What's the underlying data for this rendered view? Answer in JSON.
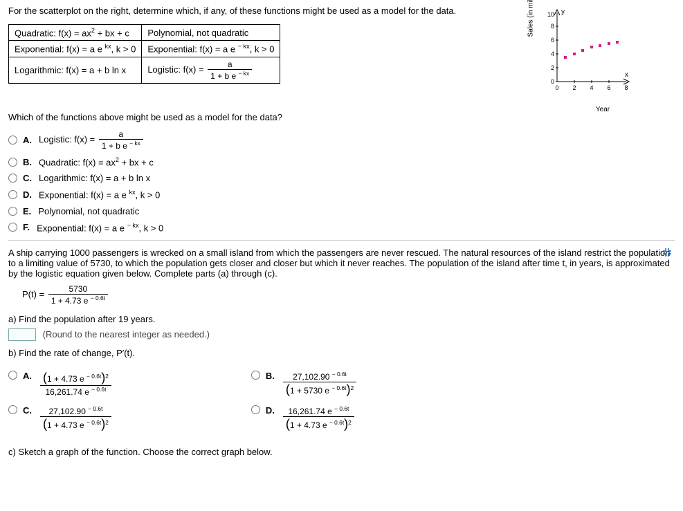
{
  "q1": {
    "prompt": "For the scatterplot on the right, determine which, if any, of these functions might be used as a model for the data.",
    "table": {
      "r1c1_pre": "Quadratic: f(x) = ax",
      "r1c1_post": " + bx + c",
      "r1c2": "Polynomial, not quadratic",
      "r2c1_pre": "Exponential: f(x) = a e ",
      "r2c1_exp": "kx",
      "r2c1_post": ", k > 0",
      "r2c2_pre": "Exponential: f(x) = a e ",
      "r2c2_exp": "− kx",
      "r2c2_post": ", k > 0",
      "r3c1": "Logarithmic: f(x) = a + b ln x",
      "r3c2_pre": "Logistic: f(x) = ",
      "r3c2_num": "a",
      "r3c2_den_pre": "1 + b e ",
      "r3c2_den_exp": "− kx"
    },
    "subprompt": "Which of the functions above might be used as a model for the data?",
    "choices": {
      "A": {
        "letter": "A.",
        "pre": "Logistic: f(x) = ",
        "num": "a",
        "den_pre": "1 + b e ",
        "den_exp": "− kx"
      },
      "B": {
        "letter": "B.",
        "pre": "Quadratic: f(x) = ax",
        "post": " + bx + c"
      },
      "C": {
        "letter": "C.",
        "text": "Logarithmic: f(x) = a + b ln x"
      },
      "D": {
        "letter": "D.",
        "pre": "Exponential: f(x) = a e ",
        "exp": "kx",
        "post": ", k > 0"
      },
      "E": {
        "letter": "E.",
        "text": "Polynomial, not quadratic"
      },
      "F": {
        "letter": "F.",
        "pre": "Exponential: f(x) = a e ",
        "exp": "− kx",
        "post": ", k > 0"
      }
    }
  },
  "chart_data": {
    "type": "scatter",
    "x": [
      1,
      2,
      3,
      4,
      5,
      6,
      7
    ],
    "y": [
      3.5,
      4,
      4.5,
      5,
      5.2,
      5.5,
      5.7
    ],
    "xlabel": "Year",
    "ylabel": "Sales (in millions)",
    "xlim": [
      0,
      8
    ],
    "ylim": [
      0,
      10
    ],
    "xticks": [
      0,
      2,
      4,
      6,
      8
    ],
    "yticks": [
      0,
      2,
      4,
      6,
      8,
      10
    ],
    "xaxis_label_end": "x",
    "yaxis_label_end": "y"
  },
  "q2": {
    "prompt": "A ship carrying 1000 passengers is wrecked on a small island from which the passengers are never rescued. The natural resources of the island restrict the population to a limiting value of 5730, to which the population gets closer and closer but which it never reaches. The population of the island after time t, in years, is approximated by the logistic equation given below. Complete parts (a) through (c).",
    "eq_lhs": "P(t) = ",
    "eq_num": "5730",
    "eq_den_pre": "1 + 4.73 e ",
    "eq_den_exp": "− 0.6t",
    "part_a": "a) Find the population after 19 years.",
    "hint_a": "(Round to the nearest integer as needed.)",
    "part_b": "b) Find the rate of change, P′(t).",
    "choices_b": {
      "A": {
        "letter": "A.",
        "num_pre": "(",
        "num_base": "1 + 4.73 e ",
        "num_exp": "− 0.6t",
        "num_post": ")",
        "num_sup": "2",
        "den_base": "16,261.74 e ",
        "den_exp": "− 0.6t"
      },
      "B": {
        "letter": "B.",
        "num_base": "27,102.90 ",
        "num_exp": "− 0.6t",
        "den_pre": "(",
        "den_base": "1 + 5730 e ",
        "den_exp": "− 0.6t",
        "den_post": ")",
        "den_sup": "2"
      },
      "C": {
        "letter": "C.",
        "num_base": "27,102.90 ",
        "num_exp": "− 0.6t",
        "den_pre": "(",
        "den_base": "1 + 4.73 e ",
        "den_exp": "− 0.6t",
        "den_post": ")",
        "den_sup": "2"
      },
      "D": {
        "letter": "D.",
        "num_base": "16,261.74 e ",
        "num_exp": "− 0.6t",
        "den_pre": "(",
        "den_base": "1 + 4.73 e ",
        "den_exp": "− 0.6t",
        "den_post": ")",
        "den_sup": "2"
      }
    },
    "part_c": "c) Sketch a graph of the function. Choose the correct graph below."
  }
}
